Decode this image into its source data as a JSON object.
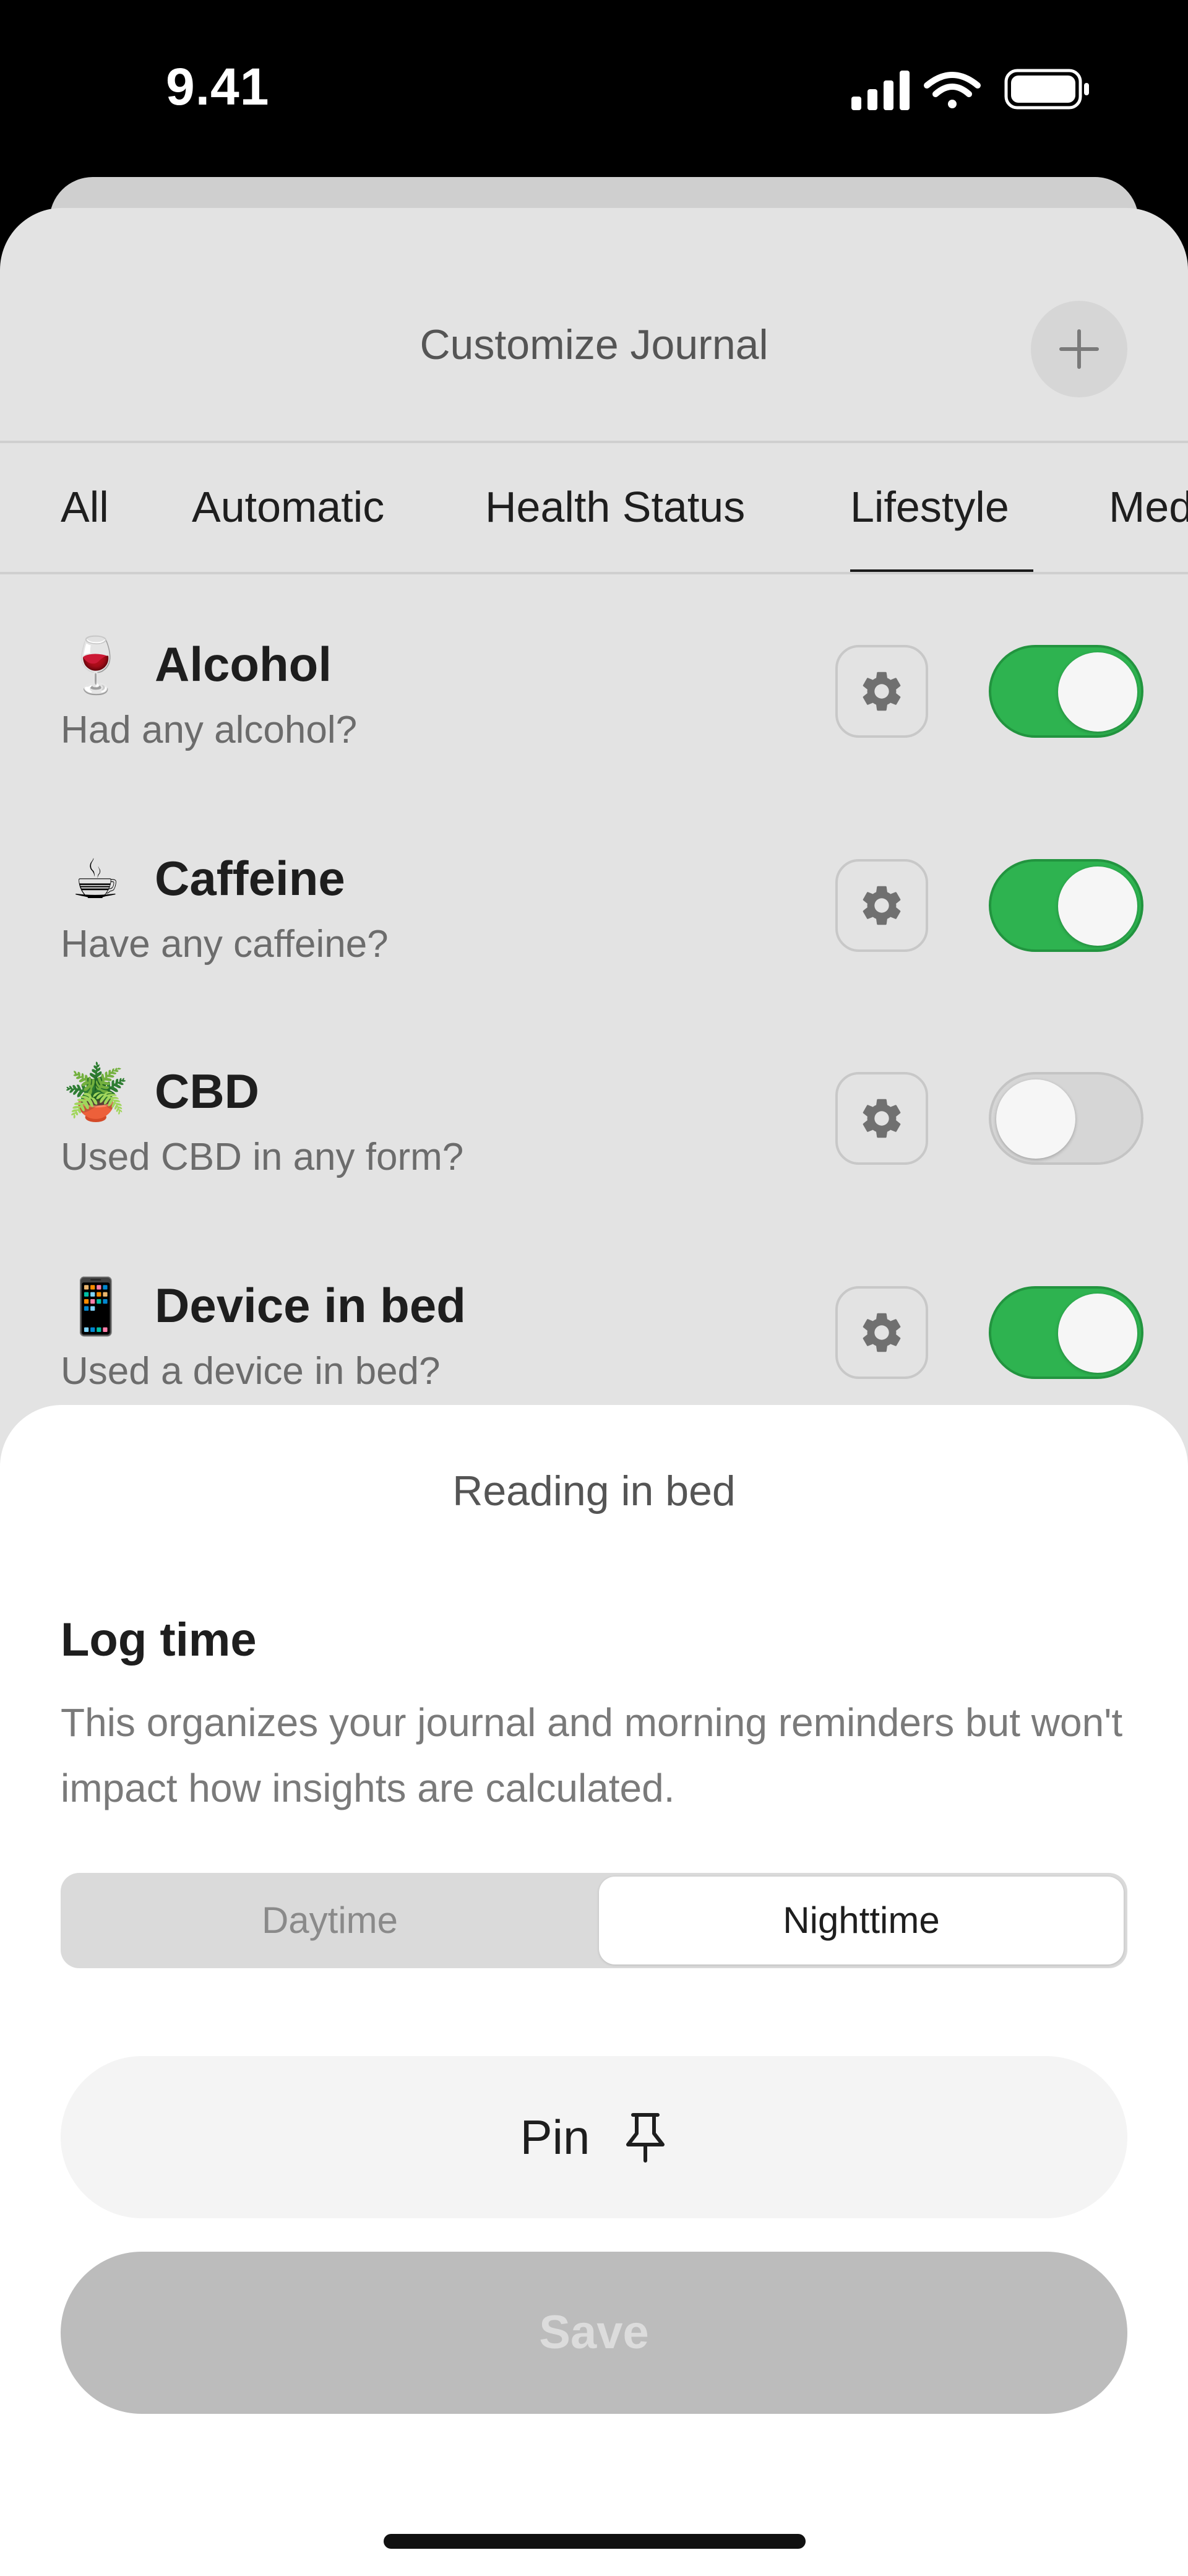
{
  "status_bar": {
    "time": "9.41",
    "icons": [
      "cellular-signal-icon",
      "wifi-icon",
      "battery-icon"
    ]
  },
  "header": {
    "title": "Customize Journal",
    "add_icon": "plus-icon"
  },
  "tabs": [
    {
      "label": "All",
      "selected": false
    },
    {
      "label": "Automatic",
      "selected": false
    },
    {
      "label": "Health Status",
      "selected": false
    },
    {
      "label": "Lifestyle",
      "selected": true
    },
    {
      "label": "Medication",
      "selected": false
    }
  ],
  "items": [
    {
      "emoji": "🍷",
      "icon": "wine-glass-icon",
      "title": "Alcohol",
      "subtitle": "Had any alcohol?",
      "enabled": true
    },
    {
      "emoji": "☕",
      "icon": "coffee-cup-icon",
      "title": "Caffeine",
      "subtitle": "Have any caffeine?",
      "enabled": true
    },
    {
      "emoji": "🪴",
      "icon": "potted-plant-icon",
      "title": "CBD",
      "subtitle": "Used CBD in any form?",
      "enabled": false
    },
    {
      "emoji": "📱",
      "icon": "mobile-phone-icon",
      "title": "Device in bed",
      "subtitle": "Used a device in bed?",
      "enabled": true
    }
  ],
  "sheet": {
    "title": "Reading in bed",
    "heading": "Log time",
    "description": "This organizes your journal and morning reminders but won't impact how insights are calculated.",
    "segments": [
      {
        "label": "Daytime",
        "selected": false
      },
      {
        "label": "Nighttime",
        "selected": true
      }
    ],
    "pin_label": "Pin",
    "pin_icon": "pushpin-icon",
    "save_label": "Save"
  },
  "colors": {
    "toggle_on": "#2eb350",
    "toggle_off": "#d6d6d6",
    "save_disabled": "#bcbcbc",
    "sheet_background": "#e3e3e3"
  }
}
